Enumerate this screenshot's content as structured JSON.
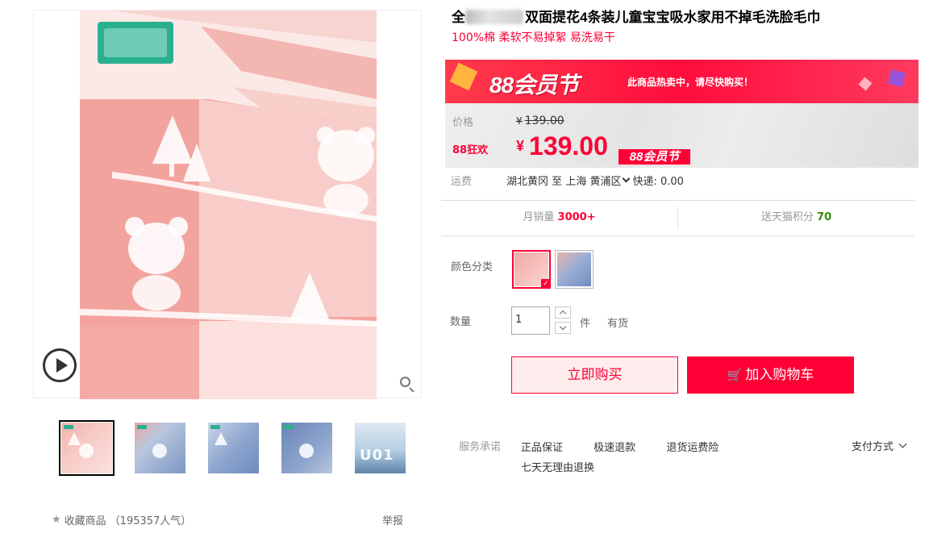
{
  "product": {
    "title": "双面提花4条装儿童宝宝吸水家用不掉毛洗脸毛巾",
    "title_prefix": "全",
    "subtitle": "100%棉 柔软不易掉絮 易洗易干"
  },
  "promo": {
    "logo_text": "88会员节",
    "hot_text": "此商品热卖中，请尽快购买！",
    "price_label": "价格",
    "currency": "¥",
    "original_price": "139.00",
    "event_label": "88狂欢",
    "sale_price": "139.00",
    "event_tag": "88会员节"
  },
  "shipping": {
    "label": "运费",
    "from": "湖北黄冈",
    "to_word": "至",
    "city": "上海",
    "district": "黄浦区",
    "fee": "快递: 0.00"
  },
  "stats": {
    "sales_label": "月销量",
    "sales_value": "3000+",
    "points_label": "送天猫积分",
    "points_value": "70"
  },
  "options": {
    "color_label": "颜色分类",
    "colors": [
      "pink",
      "blue"
    ],
    "selected_color": "pink"
  },
  "quantity": {
    "label": "数量",
    "value": "1",
    "unit": "件",
    "stock": "有货"
  },
  "actions": {
    "buy_now": "立即购买",
    "add_to_cart": "加入购物车"
  },
  "service": {
    "label": "服务承诺",
    "items": [
      "正品保证",
      "极速退款",
      "退货运费险",
      "七天无理由退换"
    ],
    "payment": "支付方式"
  },
  "gallery": {
    "thumbnail_count": 5,
    "active_index": 0,
    "thumb_text": "U01"
  },
  "footer": {
    "favorite": "收藏商品",
    "popularity": "（195357人气）",
    "report": "举报"
  },
  "colors": {
    "accent": "#ff0036",
    "points_green": "#2f8d00"
  }
}
